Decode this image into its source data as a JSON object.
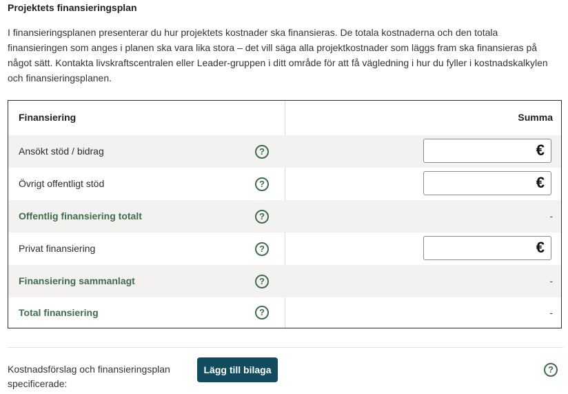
{
  "section": {
    "title": "Projektets finansieringsplan",
    "intro": "I finansieringsplanen presenterar du hur projektets kostnader ska finansieras. De totala kostnaderna och den totala finansieringen som anges i planen ska vara lika stora – det vill säga alla projektkostnader som läggs fram ska finansieras på något sätt. Kontakta livskraftscentralen eller Leader-gruppen i ditt område för att få vägledning i hur du fyller i kostnadskalkylen och finansieringsplanen."
  },
  "table": {
    "header": {
      "label": "Finansiering",
      "sum": "Summa"
    },
    "rows": [
      {
        "label": "Ansökt stöd / bidrag",
        "help": "?",
        "currency": "€",
        "value": ""
      },
      {
        "label": "Övrigt offentligt stöd",
        "help": "?",
        "currency": "€",
        "value": ""
      },
      {
        "label": "Offentlig finansiering totalt",
        "help": "?",
        "total": "-"
      },
      {
        "label": "Privat finansiering",
        "help": "?",
        "currency": "€",
        "value": ""
      },
      {
        "label": "Finansiering sammanlagt",
        "help": "?",
        "total": "-"
      },
      {
        "label": "Total finansiering",
        "help": "?",
        "total": "-"
      }
    ]
  },
  "attachment": {
    "label": "Kostnadsförslag och finansieringsplan specificerade:",
    "button": "Lägg till bilaga",
    "help": "?"
  },
  "colors": {
    "accent_green": "#3f6b4f",
    "button_bg": "#124a5e",
    "row_shade": "#f3f2f0"
  }
}
